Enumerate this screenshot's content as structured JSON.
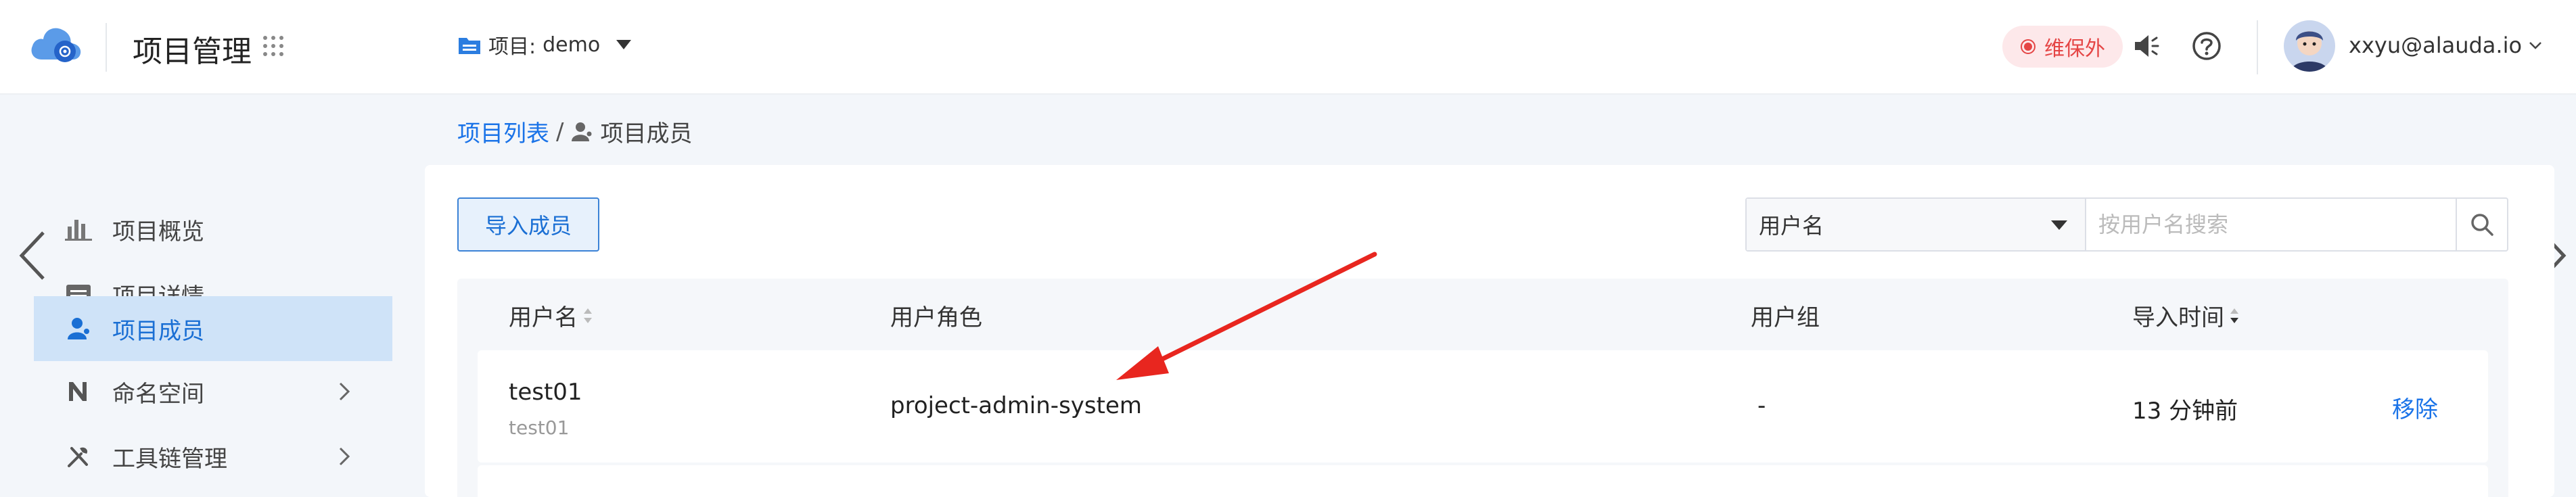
{
  "header": {
    "app_title": "项目管理",
    "project_label": "项目:",
    "project_name": "demo",
    "maintenance_badge": "维保外",
    "user_email": "xxyu@alauda.io"
  },
  "breadcrumb": {
    "parent": "项目列表",
    "separator": "/",
    "current": "项目成员"
  },
  "sidebar": {
    "items": [
      {
        "label": "项目概览",
        "icon": "bar-chart-icon",
        "active": false
      },
      {
        "label": "项目详情",
        "icon": "detail-list-icon",
        "active": false
      },
      {
        "label": "项目成员",
        "icon": "user-icon",
        "active": true
      },
      {
        "label": "命名空间",
        "icon": "namespace-n-icon",
        "active": false
      },
      {
        "label": "工具链管理",
        "icon": "tools-icon",
        "active": false
      }
    ]
  },
  "toolbar": {
    "import_label": "导入成员",
    "search_select_value": "用户名",
    "search_placeholder": "按用户名搜索"
  },
  "table": {
    "columns": [
      "用户名",
      "用户角色",
      "用户组",
      "导入时间"
    ],
    "rows": [
      {
        "username": "test01",
        "display_name": "test01",
        "role": "project-admin-system",
        "group": "-",
        "imported": "13 分钟前",
        "action": "移除"
      }
    ]
  },
  "colors": {
    "accent": "#1a73e8",
    "active_nav_bg": "#cfe3f8",
    "badge_text": "#e54545",
    "annotation": "#e8261f"
  }
}
